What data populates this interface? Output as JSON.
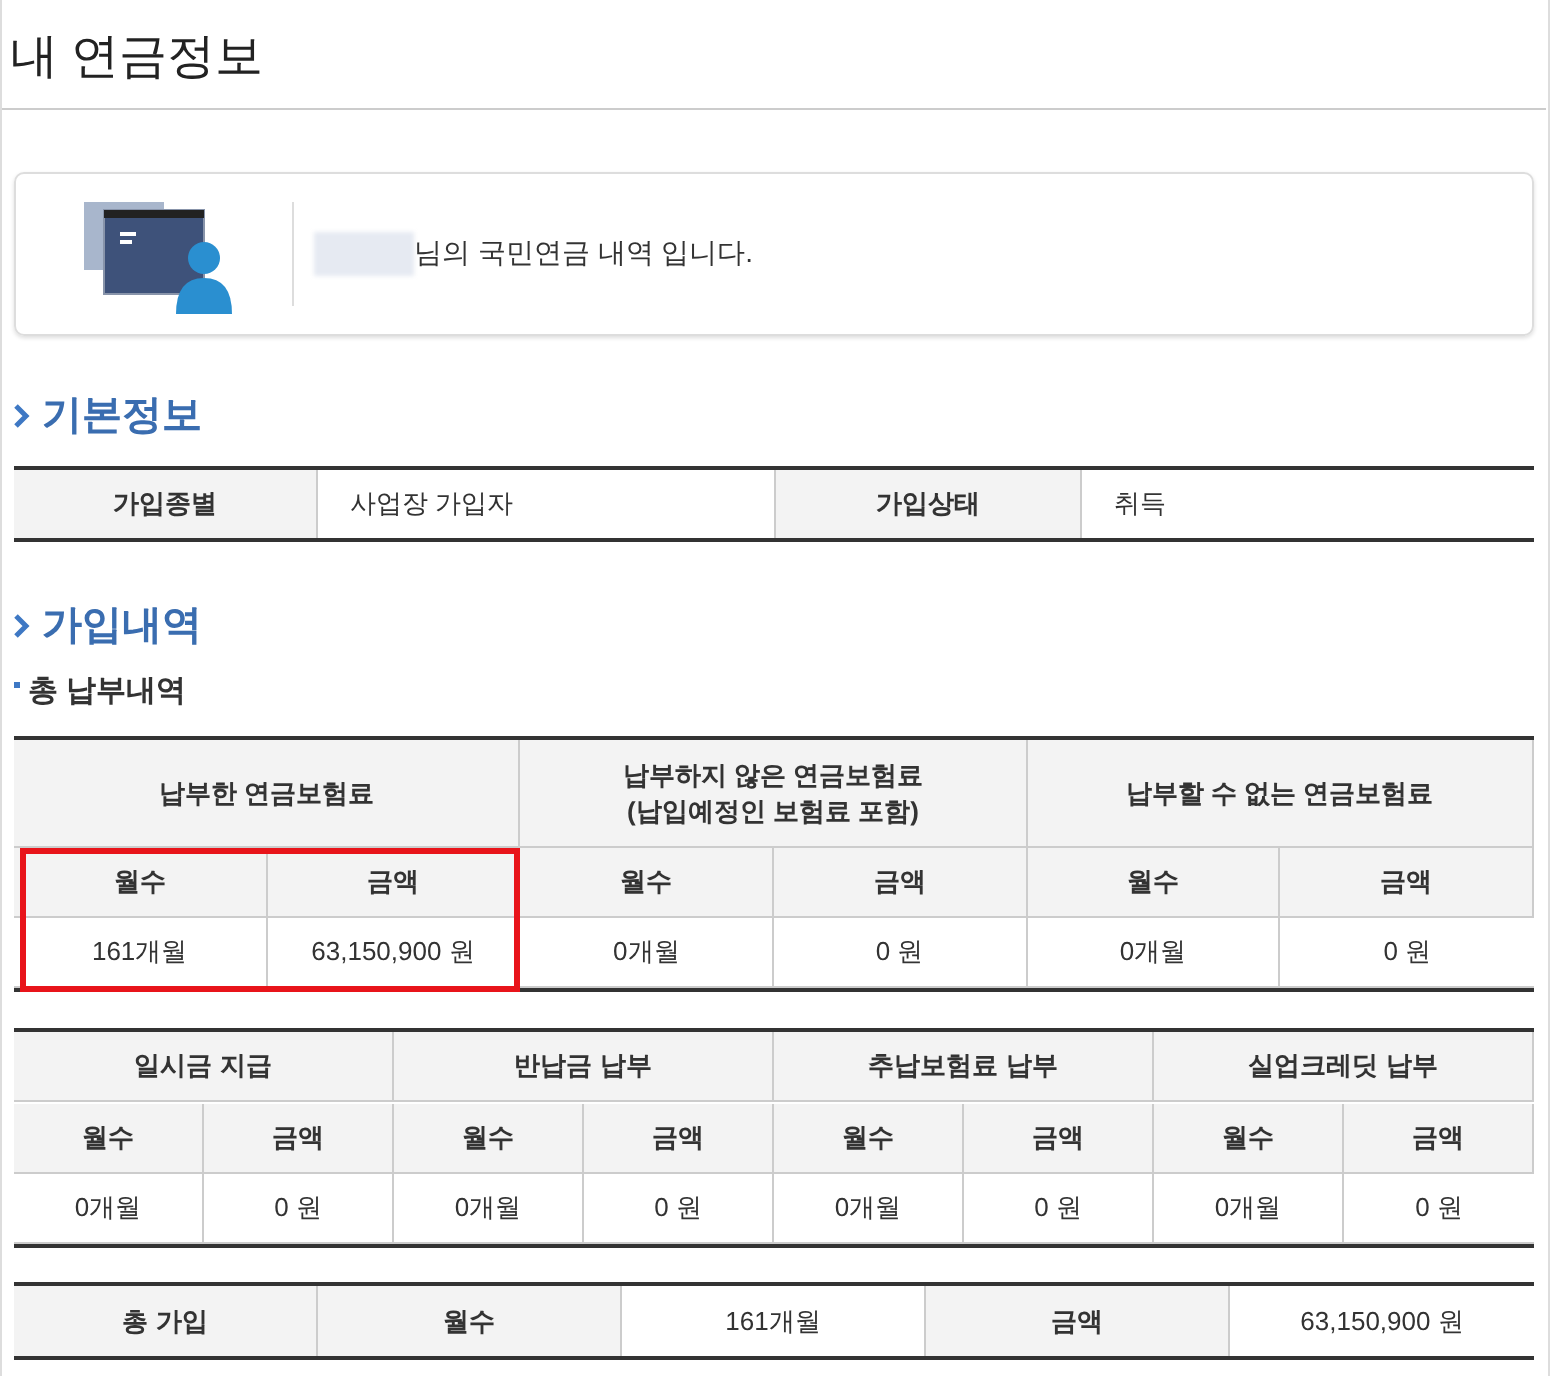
{
  "page_title": "내 연금정보",
  "intro": {
    "message": "님의 국민연금 내역 입니다."
  },
  "basic_info": {
    "heading": "기본정보",
    "fields": [
      {
        "label": "가입종별",
        "value": "사업장 가입자"
      },
      {
        "label": "가입상태",
        "value": "취득"
      }
    ]
  },
  "enrollment": {
    "heading": "가입내역",
    "subheading": "총 납부내역",
    "payment_table": {
      "groups": [
        {
          "title": "납부한 연금보험료",
          "highlighted": true,
          "columns": [
            "월수",
            "금액"
          ],
          "values": [
            "161개월",
            "63,150,900 원"
          ]
        },
        {
          "title": "납부하지 않은 연금보험료",
          "note": "(납입예정인 보험료 포함)",
          "highlighted": false,
          "columns": [
            "월수",
            "금액"
          ],
          "values": [
            "0개월",
            "0 원"
          ]
        },
        {
          "title": "납부할 수 없는 연금보험료",
          "highlighted": false,
          "columns": [
            "월수",
            "금액"
          ],
          "values": [
            "0개월",
            "0 원"
          ]
        }
      ]
    },
    "other_table": {
      "groups": [
        {
          "title": "일시금 지급",
          "columns": [
            "월수",
            "금액"
          ],
          "values": [
            "0개월",
            "0 원"
          ]
        },
        {
          "title": "반납금 납부",
          "columns": [
            "월수",
            "금액"
          ],
          "values": [
            "0개월",
            "0 원"
          ]
        },
        {
          "title": "추납보험료 납부",
          "columns": [
            "월수",
            "금액"
          ],
          "values": [
            "0개월",
            "0 원"
          ]
        },
        {
          "title": "실업크레딧 납부",
          "columns": [
            "월수",
            "금액"
          ],
          "values": [
            "0개월",
            "0 원"
          ]
        }
      ]
    },
    "total": {
      "label": "총 가입",
      "cells": [
        {
          "label": "월수",
          "value": "161개월"
        },
        {
          "label": "금액",
          "value": "63,150,900 원"
        }
      ]
    }
  }
}
